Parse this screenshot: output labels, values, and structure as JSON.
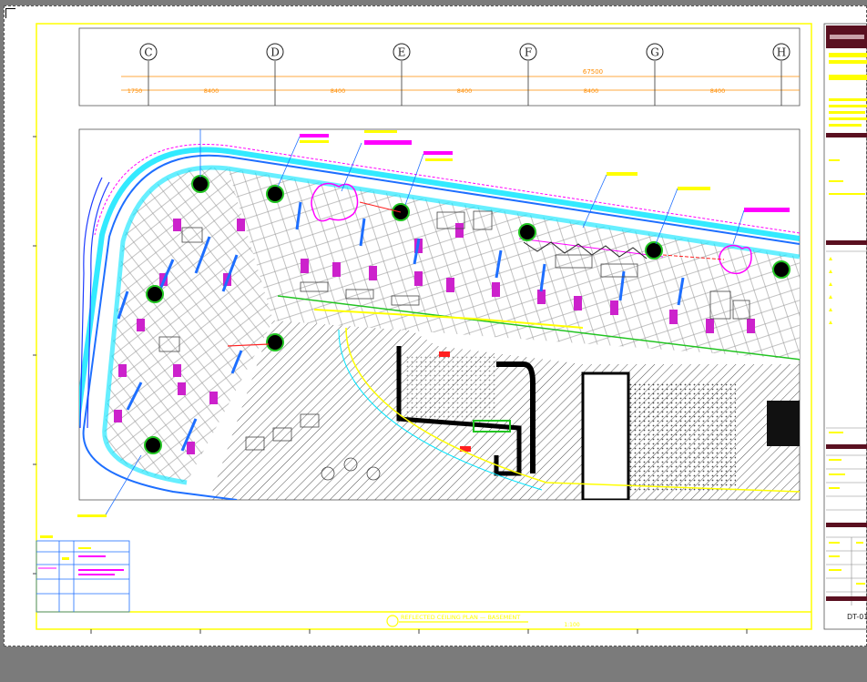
{
  "gridline_labels": [
    "C",
    "D",
    "E",
    "F",
    "G",
    "H"
  ],
  "dimensions": {
    "overall": "67500",
    "segments": [
      "1750",
      "8400",
      "8400",
      "8400",
      "8400",
      "8400"
    ]
  },
  "drawing_title": "REFLECTED CEILING PLAN — BASEMENT",
  "scale_text": "1:100",
  "sheet_number": "DT-01",
  "colors": {
    "border": "#ffff00",
    "cyan": "#00e5ff",
    "magenta": "#ff00ff",
    "blue": "#1e6fff",
    "green": "#22c422",
    "red": "#ff2020",
    "title_header": "#5a1020"
  },
  "legend": {
    "rows": 4,
    "columns": 4
  }
}
